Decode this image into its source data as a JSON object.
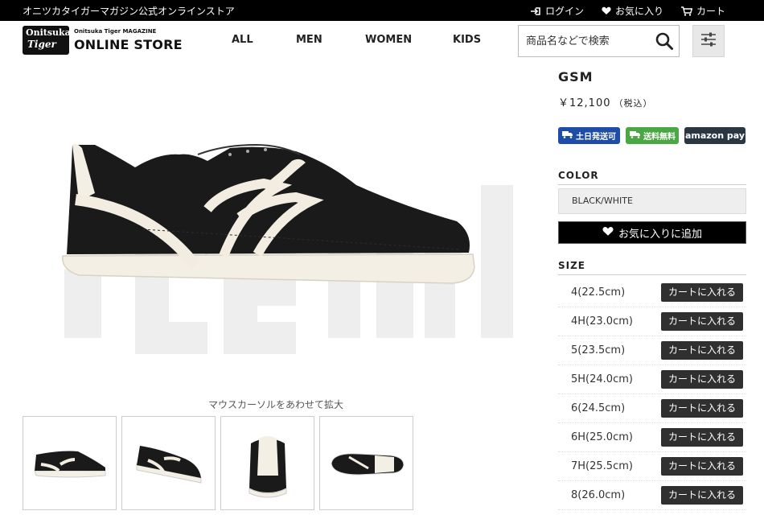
{
  "topbar": {
    "store_name": "オニツカタイガーマガジン公式オンラインストア",
    "login": "ログイン",
    "favorites": "お気に入り",
    "cart": "カート"
  },
  "header": {
    "logo_badge_line1": "Onitsuka",
    "logo_badge_line2": "Tiger",
    "logo_sub": "Onitsuka Tiger MAGAZINE",
    "logo_main": "ONLINE STORE",
    "nav": [
      "ALL",
      "MEN",
      "WOMEN",
      "KIDS"
    ],
    "search_placeholder": "商品名などで検索"
  },
  "product": {
    "title": "GSM",
    "price": "￥12,100",
    "tax": "（税込）",
    "badges": {
      "weekend": "土日発送可",
      "free_ship": "送料無料",
      "amazon_pay": "amazon pay"
    },
    "color_heading": "COLOR",
    "color_selected": "BLACK/WHITE",
    "favorite_button": "お気に入りに追加",
    "size_heading": "SIZE",
    "cart_label": "カートに入れる",
    "sizes": [
      "4(22.5cm)",
      "4H(23.0cm)",
      "5(23.5cm)",
      "5H(24.0cm)",
      "6(24.5cm)",
      "6H(25.0cm)",
      "7H(25.5cm)",
      "8(26.0cm)"
    ],
    "zoom_hint": "マウスカーソルをあわせて拡大"
  },
  "colors": {
    "topbar": "#000000",
    "shoe_body": "#1a1a1a",
    "shoe_stripes": "#f2ede0",
    "badge_blue": "#1f4da6",
    "badge_green": "#4aa743",
    "cart_button": "#303030"
  }
}
